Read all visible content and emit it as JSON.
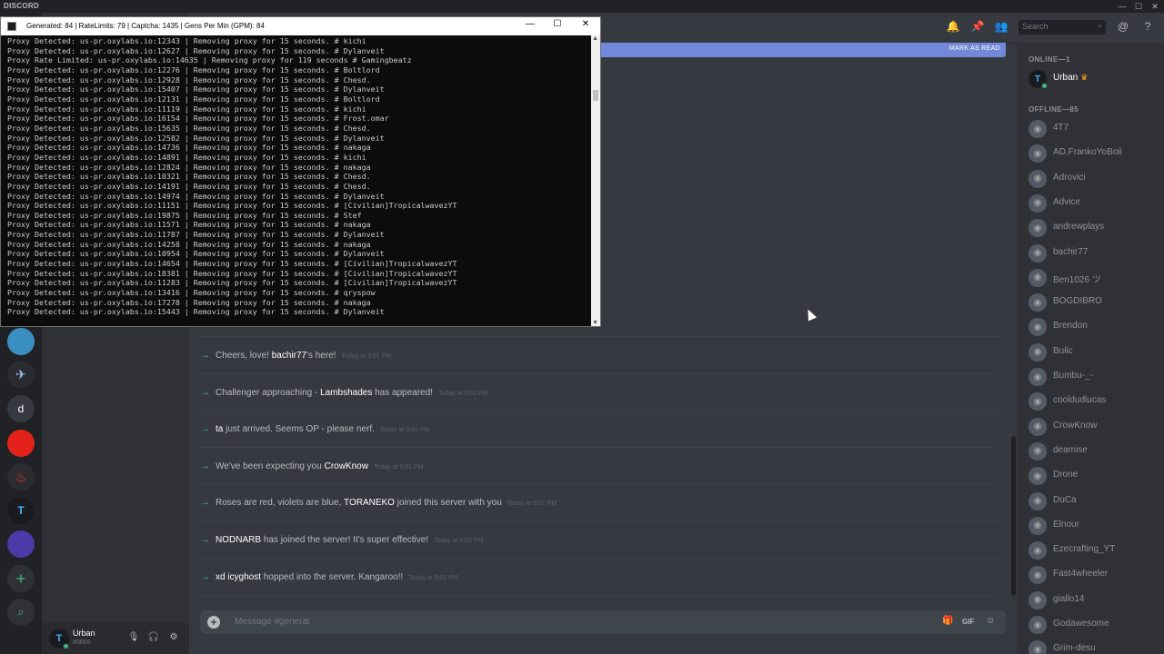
{
  "app": {
    "brand": "DISCORD"
  },
  "window_controls": [
    "—",
    "☐",
    "✕"
  ],
  "console": {
    "title": "Generated: 84 | RateLimits: 79 | Captcha: 1435 | Gens Per Min (GPM): 84",
    "lines": [
      "Proxy Detected: us-pr.oxylabs.io:12343 | Removing proxy for 15 seconds. # kichi",
      "Proxy Detected: us-pr.oxylabs.io:12627 | Removing proxy for 15 seconds. # Dylanveit",
      "Proxy Rate Limited: us-pr.oxylabs.io:14635 | Removing proxy for 119 seconds # Gamingbeatz",
      "Proxy Detected: us-pr.oxylabs.io:12276 | Removing proxy for 15 seconds. # Boltlord",
      "Proxy Detected: us-pr.oxylabs.io:12928 | Removing proxy for 15 seconds. # Chesd.",
      "Proxy Detected: us-pr.oxylabs.io:15407 | Removing proxy for 15 seconds. # Dylanveit",
      "Proxy Detected: us-pr.oxylabs.io:12131 | Removing proxy for 15 seconds. # Boltlord",
      "Proxy Detected: us-pr.oxylabs.io:11119 | Removing proxy for 15 seconds. # kichi",
      "Proxy Detected: us-pr.oxylabs.io:16154 | Removing proxy for 15 seconds. # Frost.omar",
      "Proxy Detected: us-pr.oxylabs.io:15635 | Removing proxy for 15 seconds. # Chesd.",
      "Proxy Detected: us-pr.oxylabs.io:12582 | Removing proxy for 15 seconds. # Dylanveit",
      "Proxy Detected: us-pr.oxylabs.io:14736 | Removing proxy for 15 seconds. # nakaga",
      "Proxy Detected: us-pr.oxylabs.io:14891 | Removing proxy for 15 seconds. # kichi",
      "Proxy Detected: us-pr.oxylabs.io:12824 | Removing proxy for 15 seconds. # nakaga",
      "Proxy Detected: us-pr.oxylabs.io:10321 | Removing proxy for 15 seconds. # Chesd.",
      "Proxy Detected: us-pr.oxylabs.io:14191 | Removing proxy for 15 seconds. # Chesd.",
      "Proxy Detected: us-pr.oxylabs.io:14974 | Removing proxy for 15 seconds. # Dylanveit",
      "Proxy Detected: us-pr.oxylabs.io:11151 | Removing proxy for 15 seconds. # [Civilian]TropicalwavezYT",
      "Proxy Detected: us-pr.oxylabs.io:19875 | Removing proxy for 15 seconds. # Stef",
      "Proxy Detected: us-pr.oxylabs.io:11571 | Removing proxy for 15 seconds. # nakaga",
      "Proxy Detected: us-pr.oxylabs.io:11787 | Removing proxy for 15 seconds. # Dylanveit",
      "Proxy Detected: us-pr.oxylabs.io:14258 | Removing proxy for 15 seconds. # nakaga",
      "Proxy Detected: us-pr.oxylabs.io:10954 | Removing proxy for 15 seconds. # Dylanveit",
      "Proxy Detected: us-pr.oxylabs.io:14654 | Removing proxy for 15 seconds. # [Civilian]TropicalwavezYT",
      "Proxy Detected: us-pr.oxylabs.io:18381 | Removing proxy for 15 seconds. # [Civilian]TropicalwavezYT",
      "Proxy Detected: us-pr.oxylabs.io:11283 | Removing proxy for 15 seconds. # [Civilian]TropicalwavezYT",
      "Proxy Detected: us-pr.oxylabs.io:13416 | Removing proxy for 15 seconds. # qryspow",
      "Proxy Detected: us-pr.oxylabs.io:17278 | Removing proxy for 15 seconds. # nakaga",
      "Proxy Detected: us-pr.oxylabs.io:15443 | Removing proxy for 15 seconds. # Dylanveit"
    ]
  },
  "header": {
    "search_placeholder": "Search",
    "mark_as_read": "MARK AS READ"
  },
  "guild_letter": "d",
  "messages": [
    {
      "pre": "Cheers, love! ",
      "name": "bachir77",
      "post": "'s here!",
      "time": "Today at 9:01 PM"
    },
    {
      "pre": "Challenger approaching - ",
      "name": "Lambshades",
      "post": " has appeared!",
      "time": "Today at 9:01 PM"
    },
    {
      "pre": "",
      "name": "ta",
      "post": " just arrived. Seems OP - please nerf.",
      "time": "Today at 9:01 PM"
    },
    {
      "pre": "We've been expecting you ",
      "name": "CrowKnow",
      "post": "",
      "time": "Today at 9:01 PM"
    },
    {
      "pre": "Roses are red, violets are blue, ",
      "name": "TORANEKO",
      "post": " joined this server with you",
      "time": "Today at 9:01 PM"
    },
    {
      "pre": "",
      "name": "NODNARB",
      "post": " has joined the server! It's super effective!",
      "time": "Today at 9:01 PM"
    },
    {
      "pre": "",
      "name": "xd icyghost",
      "post": " hopped into the server. Kangaroo!!",
      "time": "Today at 9:01 PM"
    }
  ],
  "composer": {
    "placeholder": "Message #general"
  },
  "user": {
    "name": "Urban",
    "tag": "#0666"
  },
  "members": {
    "online_header": "ONLINE—1",
    "online": [
      {
        "name": "Urban"
      }
    ],
    "offline_header": "OFFLINE—85",
    "offline": [
      "4T7",
      "AD.FrankoYoBoii",
      "Adrovici",
      "Advice",
      "andrewplays",
      "bachir77",
      "Ben1026 ツ",
      "BOGDIBRO",
      "Brendon",
      "Bulic",
      "Bumbu-_-",
      "cooldudlucas",
      "CrowKnow",
      "deamise",
      "Drone",
      "DuCa",
      "Elnour",
      "Ezecrafting_YT",
      "Fast4wheeler",
      "giallo14",
      "Godawesome",
      "Grim-desu"
    ]
  },
  "colors": {
    "accent": "#7289da",
    "online": "#43b581",
    "bg": "#36393f"
  }
}
